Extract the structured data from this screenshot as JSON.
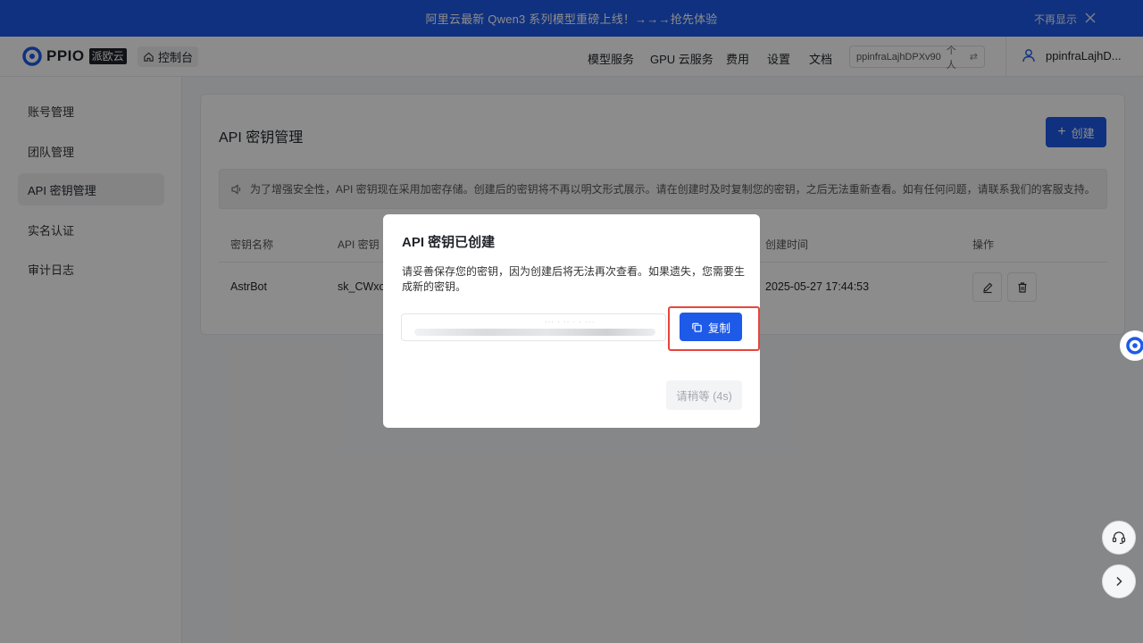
{
  "banner": {
    "message": "阿里云最新 Qwen3 系列模型重磅上线！→→→抢先体验",
    "dismiss_label": "不再显示"
  },
  "header": {
    "brand": "PPIO",
    "brand_badge": "派欧云",
    "console_label": "控制台",
    "nav": [
      "模型服务",
      "GPU 云服务",
      "费用",
      "设置",
      "文档"
    ],
    "account_id": "ppinfraLajhDPXv90",
    "account_type": "个人",
    "username": "ppinfraLajhD..."
  },
  "sidebar": {
    "items": [
      {
        "label": "账号管理",
        "active": false
      },
      {
        "label": "团队管理",
        "active": false
      },
      {
        "label": "API 密钥管理",
        "active": true
      },
      {
        "label": "实名认证",
        "active": false
      },
      {
        "label": "审计日志",
        "active": false
      }
    ]
  },
  "main": {
    "title": "API 密钥管理",
    "create_label": "创建",
    "notice": "为了增强安全性，API 密钥现在采用加密存储。创建后的密钥将不再以明文形式展示。请在创建时及时复制您的密钥，之后无法重新查看。如有任何问题，请联系我们的客服支持。",
    "table": {
      "columns": [
        "密钥名称",
        "API 密钥",
        "创建时间",
        "操作"
      ],
      "rows": [
        {
          "name": "AstrBot",
          "key": "sk_CWxo",
          "created": "2025-05-27 17:44:53"
        }
      ]
    }
  },
  "modal": {
    "title": "API 密钥已创建",
    "description": "请妥善保存您的密钥，因为创建后将无法再次查看。如果遗失，您需要生成新的密钥。",
    "copy_label": "复制",
    "wait_label": "请稍等 (4s)"
  },
  "colors": {
    "accent": "#1e5ae8",
    "highlight": "#e8453c"
  }
}
